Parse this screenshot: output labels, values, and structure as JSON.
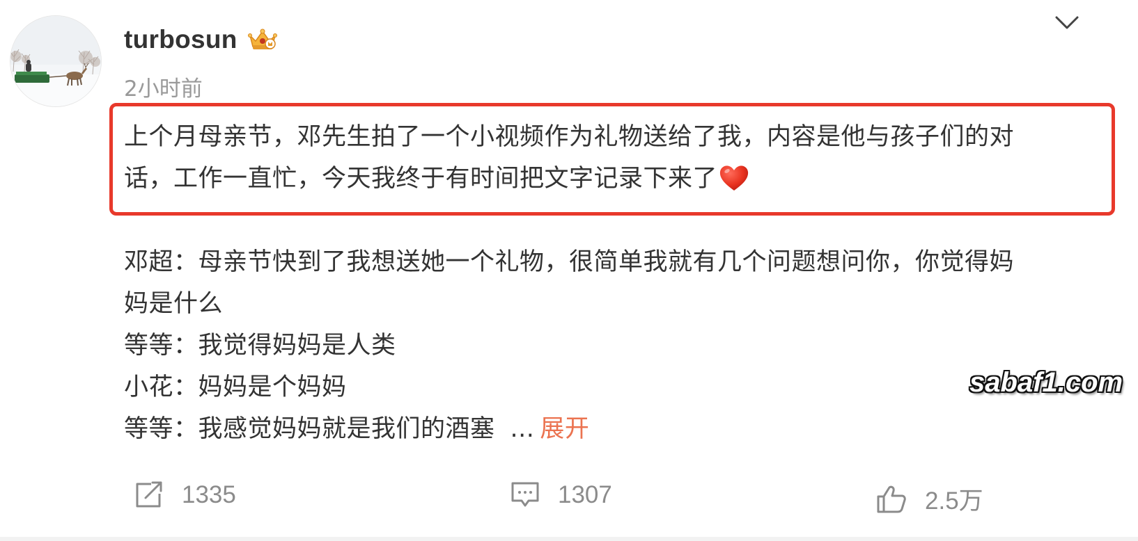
{
  "post": {
    "username": "turbosun",
    "timestamp": "2小时前",
    "highlighted_text": {
      "line1": "上个月母亲节，邓先生拍了一个小视频作为礼物送给了我，内容是他与孩子们的对",
      "line2": "话，工作一直忙，今天我终于有时间把文字记录下来了"
    },
    "body_lines": [
      "邓超：母亲节快到了我想送她一个礼物，很简单我就有几个问题想问你，你觉得妈",
      "妈是什么",
      "等等：我觉得妈妈是人类",
      "小花：妈妈是个妈妈",
      "等等：我感觉妈妈就是我们的酒塞"
    ],
    "ellipsis": "...",
    "expand_label": "展开"
  },
  "actions": {
    "share_count": "1335",
    "comment_count": "1307",
    "like_count": "2.5万"
  },
  "watermark": "sabaf1.com",
  "colors": {
    "highlight_border": "#e8392b",
    "expand_link": "#eb7350",
    "timestamp": "#999999",
    "action_gray": "#8b8b8b"
  },
  "icons": {
    "share": "share-icon",
    "comment": "comment-icon",
    "like": "thumbs-up-icon",
    "collapse": "chevron-down-icon",
    "badge": "vip-crown-badge-icon",
    "heart": "red-heart-emoji-icon"
  }
}
